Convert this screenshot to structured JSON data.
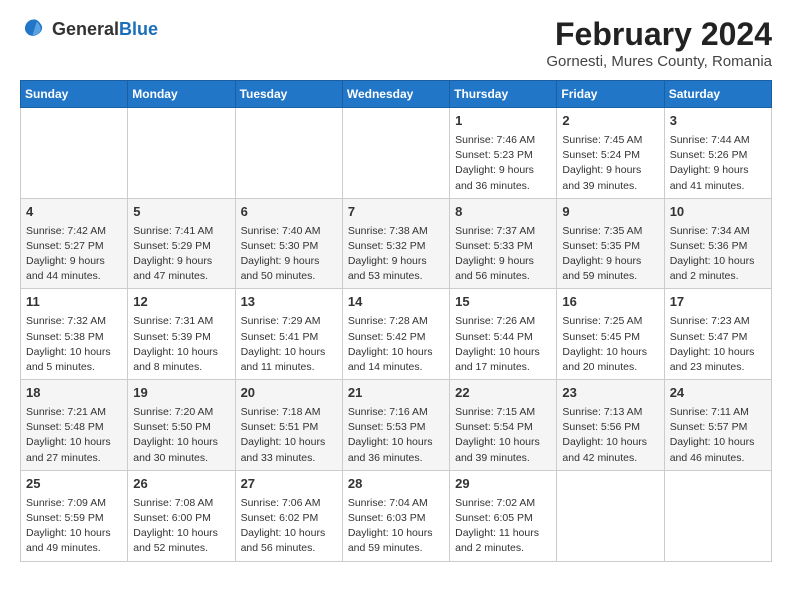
{
  "logo": {
    "line1": "General",
    "line2": "Blue"
  },
  "title": "February 2024",
  "subtitle": "Gornesti, Mures County, Romania",
  "days_of_week": [
    "Sunday",
    "Monday",
    "Tuesday",
    "Wednesday",
    "Thursday",
    "Friday",
    "Saturday"
  ],
  "weeks": [
    [
      {
        "day": "",
        "info": ""
      },
      {
        "day": "",
        "info": ""
      },
      {
        "day": "",
        "info": ""
      },
      {
        "day": "",
        "info": ""
      },
      {
        "day": "1",
        "info": "Sunrise: 7:46 AM\nSunset: 5:23 PM\nDaylight: 9 hours and 36 minutes."
      },
      {
        "day": "2",
        "info": "Sunrise: 7:45 AM\nSunset: 5:24 PM\nDaylight: 9 hours and 39 minutes."
      },
      {
        "day": "3",
        "info": "Sunrise: 7:44 AM\nSunset: 5:26 PM\nDaylight: 9 hours and 41 minutes."
      }
    ],
    [
      {
        "day": "4",
        "info": "Sunrise: 7:42 AM\nSunset: 5:27 PM\nDaylight: 9 hours and 44 minutes."
      },
      {
        "day": "5",
        "info": "Sunrise: 7:41 AM\nSunset: 5:29 PM\nDaylight: 9 hours and 47 minutes."
      },
      {
        "day": "6",
        "info": "Sunrise: 7:40 AM\nSunset: 5:30 PM\nDaylight: 9 hours and 50 minutes."
      },
      {
        "day": "7",
        "info": "Sunrise: 7:38 AM\nSunset: 5:32 PM\nDaylight: 9 hours and 53 minutes."
      },
      {
        "day": "8",
        "info": "Sunrise: 7:37 AM\nSunset: 5:33 PM\nDaylight: 9 hours and 56 minutes."
      },
      {
        "day": "9",
        "info": "Sunrise: 7:35 AM\nSunset: 5:35 PM\nDaylight: 9 hours and 59 minutes."
      },
      {
        "day": "10",
        "info": "Sunrise: 7:34 AM\nSunset: 5:36 PM\nDaylight: 10 hours and 2 minutes."
      }
    ],
    [
      {
        "day": "11",
        "info": "Sunrise: 7:32 AM\nSunset: 5:38 PM\nDaylight: 10 hours and 5 minutes."
      },
      {
        "day": "12",
        "info": "Sunrise: 7:31 AM\nSunset: 5:39 PM\nDaylight: 10 hours and 8 minutes."
      },
      {
        "day": "13",
        "info": "Sunrise: 7:29 AM\nSunset: 5:41 PM\nDaylight: 10 hours and 11 minutes."
      },
      {
        "day": "14",
        "info": "Sunrise: 7:28 AM\nSunset: 5:42 PM\nDaylight: 10 hours and 14 minutes."
      },
      {
        "day": "15",
        "info": "Sunrise: 7:26 AM\nSunset: 5:44 PM\nDaylight: 10 hours and 17 minutes."
      },
      {
        "day": "16",
        "info": "Sunrise: 7:25 AM\nSunset: 5:45 PM\nDaylight: 10 hours and 20 minutes."
      },
      {
        "day": "17",
        "info": "Sunrise: 7:23 AM\nSunset: 5:47 PM\nDaylight: 10 hours and 23 minutes."
      }
    ],
    [
      {
        "day": "18",
        "info": "Sunrise: 7:21 AM\nSunset: 5:48 PM\nDaylight: 10 hours and 27 minutes."
      },
      {
        "day": "19",
        "info": "Sunrise: 7:20 AM\nSunset: 5:50 PM\nDaylight: 10 hours and 30 minutes."
      },
      {
        "day": "20",
        "info": "Sunrise: 7:18 AM\nSunset: 5:51 PM\nDaylight: 10 hours and 33 minutes."
      },
      {
        "day": "21",
        "info": "Sunrise: 7:16 AM\nSunset: 5:53 PM\nDaylight: 10 hours and 36 minutes."
      },
      {
        "day": "22",
        "info": "Sunrise: 7:15 AM\nSunset: 5:54 PM\nDaylight: 10 hours and 39 minutes."
      },
      {
        "day": "23",
        "info": "Sunrise: 7:13 AM\nSunset: 5:56 PM\nDaylight: 10 hours and 42 minutes."
      },
      {
        "day": "24",
        "info": "Sunrise: 7:11 AM\nSunset: 5:57 PM\nDaylight: 10 hours and 46 minutes."
      }
    ],
    [
      {
        "day": "25",
        "info": "Sunrise: 7:09 AM\nSunset: 5:59 PM\nDaylight: 10 hours and 49 minutes."
      },
      {
        "day": "26",
        "info": "Sunrise: 7:08 AM\nSunset: 6:00 PM\nDaylight: 10 hours and 52 minutes."
      },
      {
        "day": "27",
        "info": "Sunrise: 7:06 AM\nSunset: 6:02 PM\nDaylight: 10 hours and 56 minutes."
      },
      {
        "day": "28",
        "info": "Sunrise: 7:04 AM\nSunset: 6:03 PM\nDaylight: 10 hours and 59 minutes."
      },
      {
        "day": "29",
        "info": "Sunrise: 7:02 AM\nSunset: 6:05 PM\nDaylight: 11 hours and 2 minutes."
      },
      {
        "day": "",
        "info": ""
      },
      {
        "day": "",
        "info": ""
      }
    ]
  ]
}
